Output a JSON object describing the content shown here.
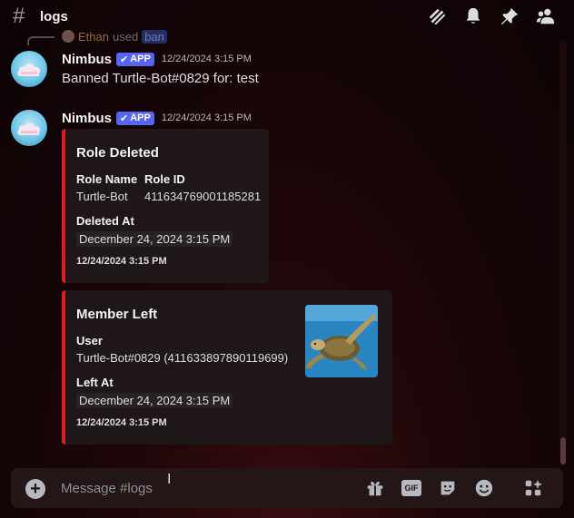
{
  "header": {
    "channel_name": "logs",
    "icons": [
      "threads-icon",
      "bell-icon",
      "pin-icon",
      "members-icon"
    ]
  },
  "reply": {
    "user": "Ethan",
    "used_text": "used",
    "command": "ban"
  },
  "messages": [
    {
      "username": "Nimbus",
      "badge": "APP",
      "timestamp": "12/24/2024 3:15 PM",
      "text": "Banned Turtle-Bot#0829 for: test"
    },
    {
      "username": "Nimbus",
      "badge": "APP",
      "timestamp": "12/24/2024 3:15 PM"
    }
  ],
  "embeds": [
    {
      "title": "Role Deleted",
      "fields": [
        {
          "name": "Role Name",
          "value": "Turtle-Bot"
        },
        {
          "name": "Role ID",
          "value": "411634769001185281"
        },
        {
          "name": "Deleted At",
          "value": "December 24, 2024 3:15 PM"
        }
      ],
      "footer": "12/24/2024 3:15 PM",
      "color": "#e01b24"
    },
    {
      "title": "Member Left",
      "fields": [
        {
          "name": "User",
          "value": "Turtle-Bot#0829 (411633897890119699)"
        },
        {
          "name": "Left At",
          "value": "December 24, 2024 3:15 PM"
        }
      ],
      "footer": "12/24/2024 3:15 PM",
      "thumbnail": "sea-turtle-image",
      "color": "#e01b24"
    }
  ],
  "composer": {
    "placeholder": "Message #logs",
    "gif_label": "GIF",
    "icons": [
      "gift-icon",
      "gif-icon",
      "sticker-icon",
      "emoji-icon",
      "apps-icon"
    ]
  }
}
